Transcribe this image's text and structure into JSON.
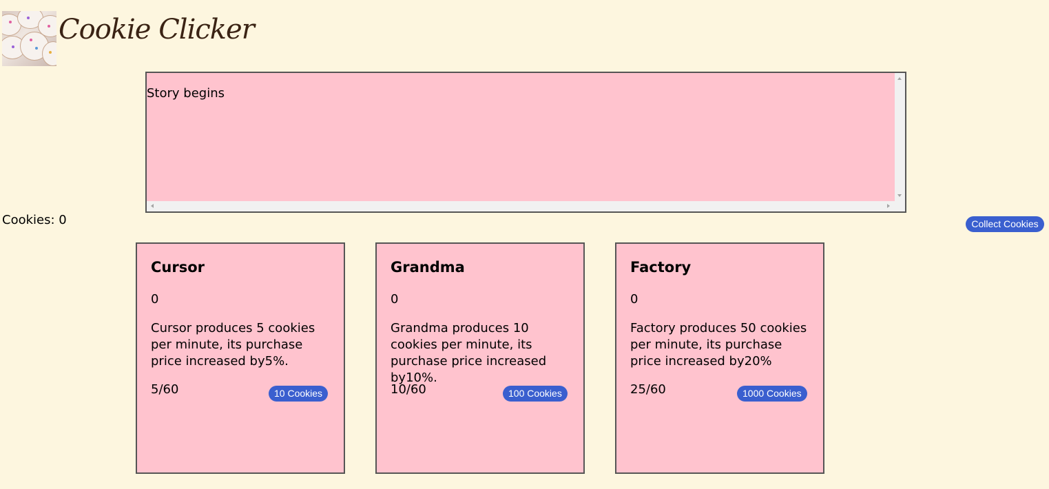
{
  "app": {
    "title": "Cookie Clicker"
  },
  "story": {
    "text": "Story begins"
  },
  "cookies": {
    "label": "Cookies: 0"
  },
  "collect_button": {
    "label": "Collect Cookies"
  },
  "cards": [
    {
      "name": "Cursor",
      "owned": "0",
      "description": "Cursor produces 5 cookies per minute, its purchase price increased by5%.",
      "rate": "5/60",
      "price_label": "10 Cookies"
    },
    {
      "name": "Grandma",
      "owned": "0",
      "description": "Grandma produces 10 cookies per minute, its purchase price increased by10%.",
      "rate": "10/60",
      "price_label": "100 Cookies"
    },
    {
      "name": "Factory",
      "owned": "0",
      "description": "Factory produces 50 cookies per minute, its purchase price increased by20%",
      "rate": "25/60",
      "price_label": "1000 Cookies"
    }
  ],
  "colors": {
    "page_background": "#fdf6df",
    "panel_background": "#ffc3ce",
    "button": "#3a5fcf",
    "title": "#3a2314"
  },
  "icons": {
    "logo": "cookie-logo-icon"
  }
}
